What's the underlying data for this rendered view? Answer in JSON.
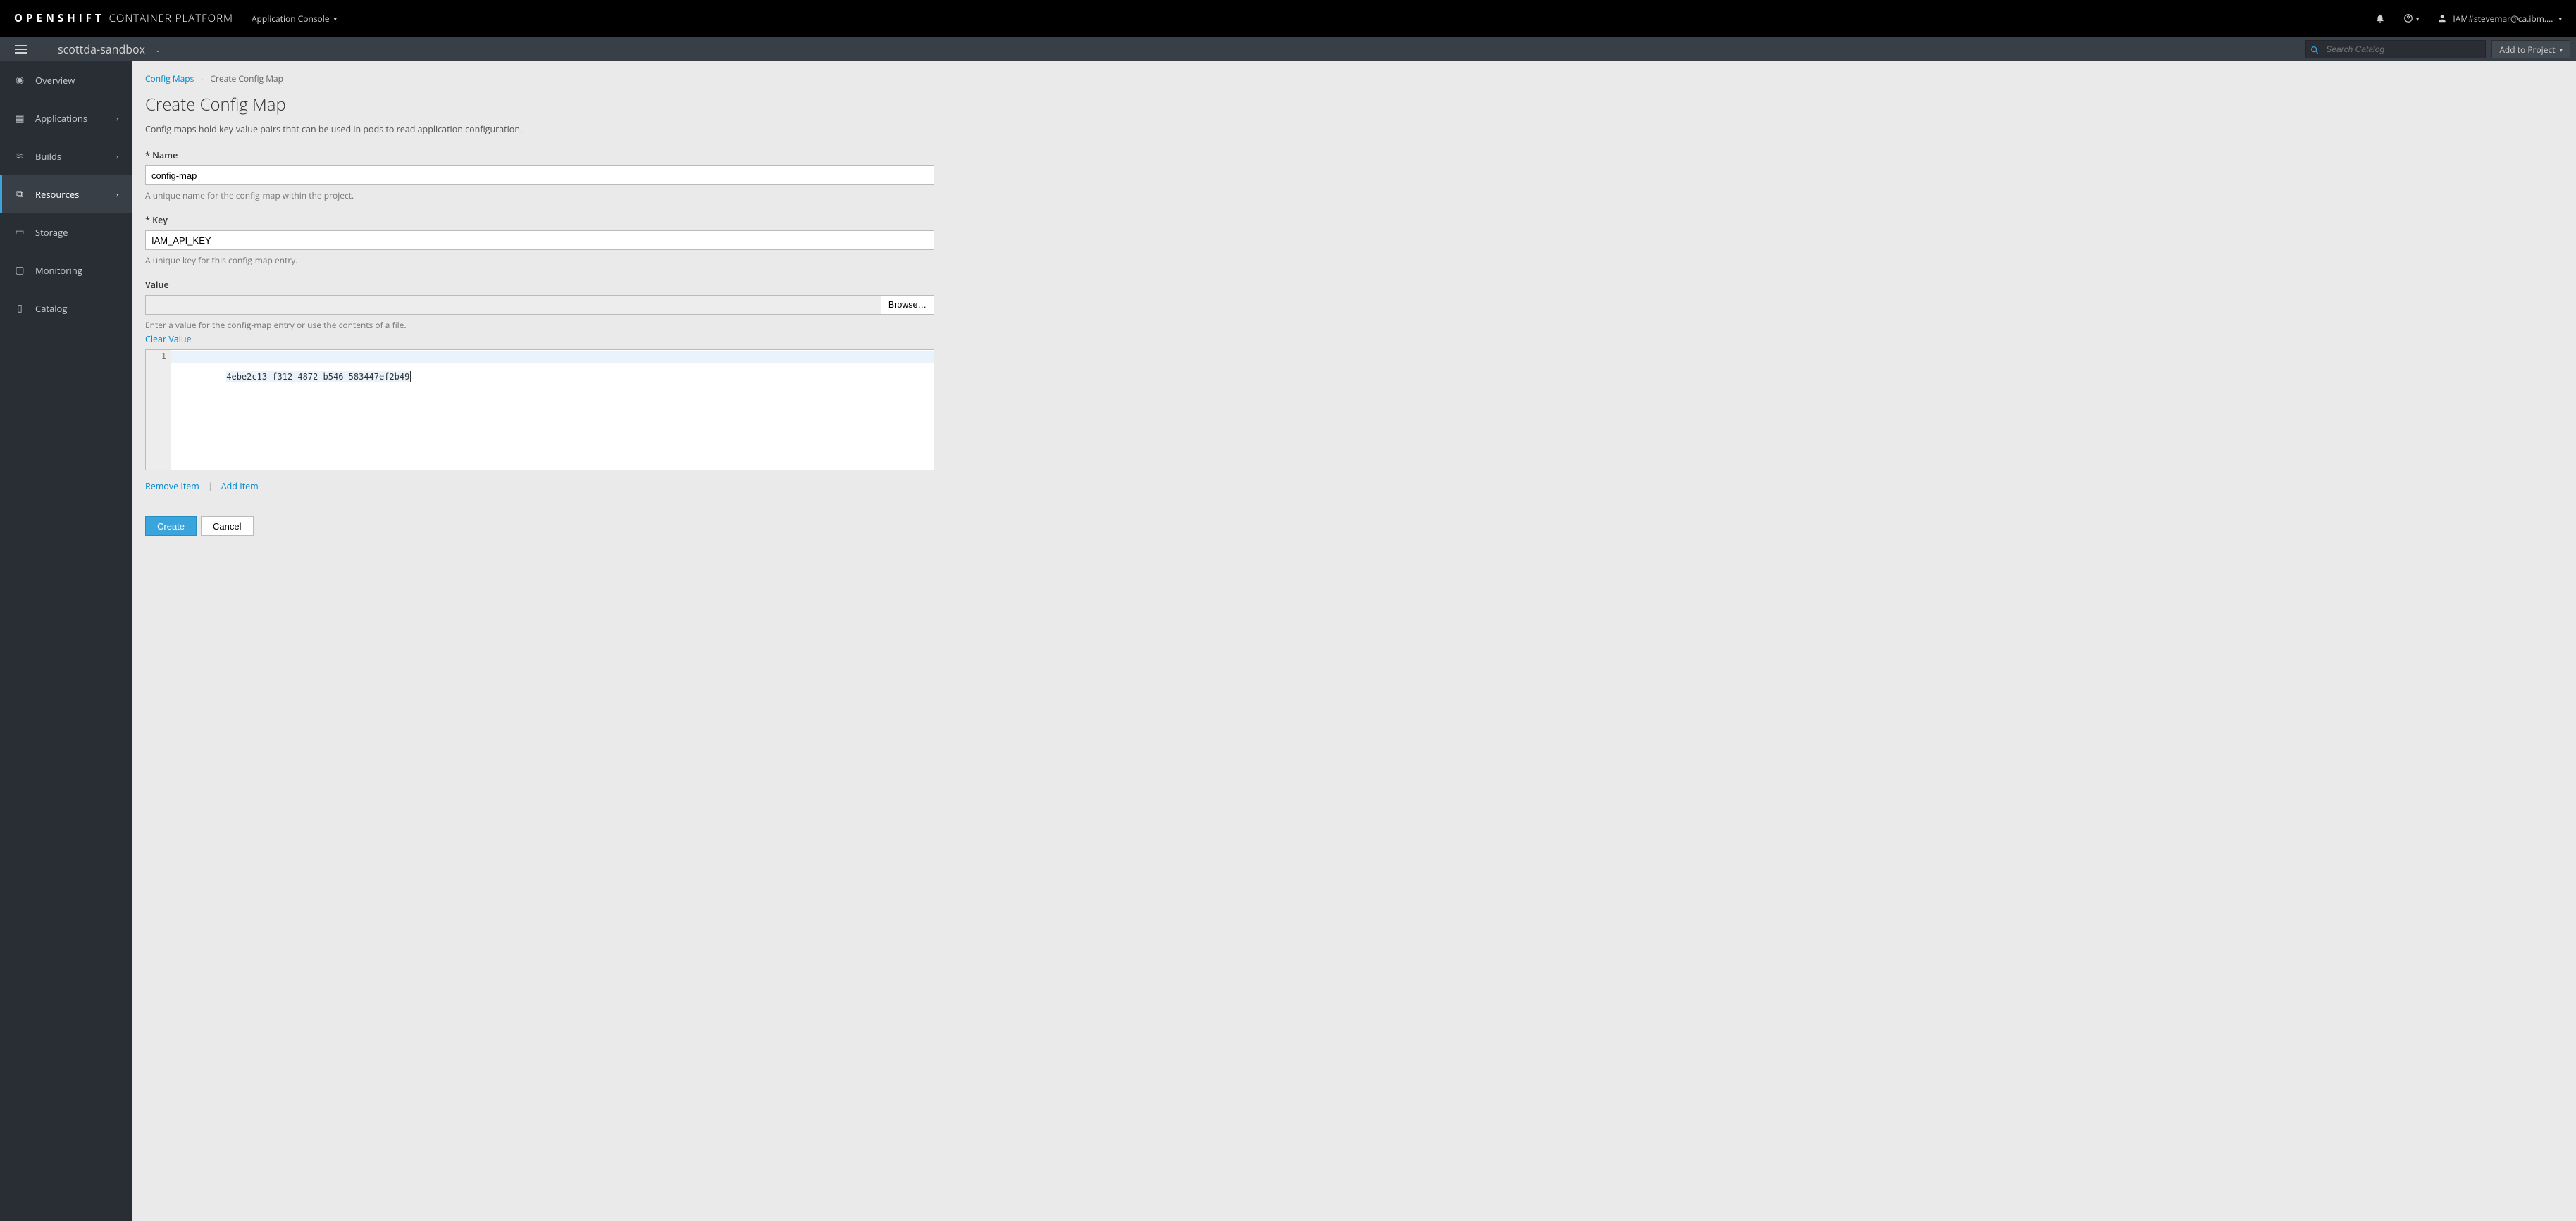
{
  "topbar": {
    "brand_bold": "OPENSHIFT",
    "brand_light": "CONTAINER PLATFORM",
    "console_label": "Application Console",
    "user_label": "IAM#stevemar@ca.ibm...."
  },
  "projbar": {
    "project_name": "scottda-sandbox",
    "search_placeholder": "Search Catalog",
    "add_to_project": "Add to Project"
  },
  "sidebar": {
    "items": [
      {
        "label": "Overview"
      },
      {
        "label": "Applications"
      },
      {
        "label": "Builds"
      },
      {
        "label": "Resources"
      },
      {
        "label": "Storage"
      },
      {
        "label": "Monitoring"
      },
      {
        "label": "Catalog"
      }
    ]
  },
  "breadcrumb": {
    "parent": "Config Maps",
    "current": "Create Config Map"
  },
  "page": {
    "title": "Create Config Map",
    "desc": "Config maps hold key-value pairs that can be used in pods to read application configuration."
  },
  "form": {
    "name_label": "Name",
    "name_value": "config-map",
    "name_help": "A unique name for the config-map within the project.",
    "key_label": "Key",
    "key_value": "IAM_API_KEY",
    "key_help": "A unique key for this config-map entry.",
    "value_label": "Value",
    "browse_label": "Browse…",
    "value_help": "Enter a value for the config-map entry or use the contents of a file.",
    "clear_value": "Clear Value",
    "code_lineno": "1",
    "code_value": "4ebe2c13-f312-4872-b546-583447ef2b49",
    "remove_item": "Remove Item",
    "add_item": "Add Item",
    "create": "Create",
    "cancel": "Cancel"
  }
}
